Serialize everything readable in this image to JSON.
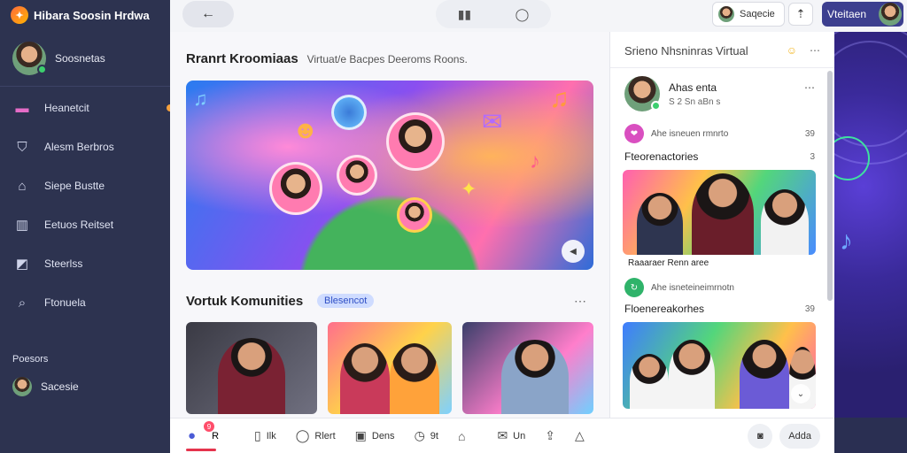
{
  "brand": {
    "name": "Hibara Soosin Hrdwa"
  },
  "sidebar": {
    "profile_name": "Soosnetas",
    "items": [
      {
        "label": "Heanetcit",
        "icon": "inbox-icon"
      },
      {
        "label": "Alesm Berbros",
        "icon": "shield-icon"
      },
      {
        "label": "Siepe Bustte",
        "icon": "basket-icon"
      },
      {
        "label": "Eetuos Reitset",
        "icon": "building-icon"
      },
      {
        "label": "Steerlss",
        "icon": "chart-icon"
      },
      {
        "label": "Ftonuela",
        "icon": "search-icon"
      }
    ],
    "section_label": "Poesors",
    "small_profile_name": "Sacesie"
  },
  "topbar": {
    "account_name": "Saqecie",
    "user_label": "Vteitaen"
  },
  "main": {
    "feature_title": "Rranrt Kroomiaas",
    "feature_tags": "Virtuat/e Bacpes   Deeroms Roons.",
    "section_title": "Vortuk Komunities",
    "section_badge": "Blesencot"
  },
  "right_panel": {
    "header_title": "Srieno Nhsninras",
    "header_subtitle": "Virtual",
    "post_author": "Ahas enta",
    "post_meta": "S 2 Sn aBn s",
    "row1_text": "Ahe isneuen rmnrto",
    "row1_count": "39",
    "title1": "Fteorenactories",
    "title1_count": "3",
    "caption1": "Raaaraer Renn aree",
    "row2_text": "Ahe isneteineimrnotn",
    "title2": "Floenereakorhes",
    "title2_count": "39"
  },
  "bottombar": {
    "items": [
      {
        "label": "R",
        "icon": "home-icon"
      },
      {
        "label": "Ilk",
        "icon": "bookmark-icon"
      },
      {
        "label": "Rlert",
        "icon": "chat-icon"
      },
      {
        "label": "Dens",
        "icon": "calendar-icon"
      },
      {
        "label": "9t",
        "icon": "clock-icon"
      },
      {
        "label": "",
        "icon": "house-icon"
      },
      {
        "label": "Un",
        "icon": "message-icon"
      },
      {
        "label": "",
        "icon": "upload-icon"
      },
      {
        "label": "",
        "icon": "share-icon"
      }
    ],
    "notif_count": "9",
    "add_label": "Adda"
  }
}
